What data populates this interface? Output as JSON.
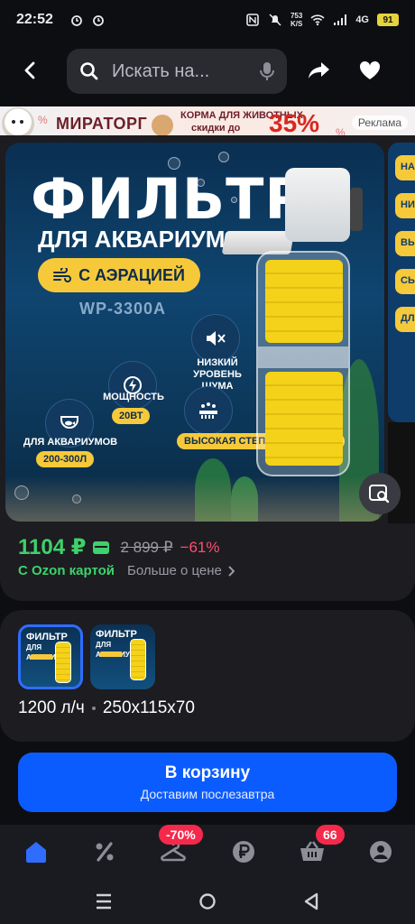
{
  "status_bar": {
    "time": "22:52",
    "speed_value": "753",
    "speed_unit": "K/S",
    "network": "4G",
    "battery": "91"
  },
  "topbar": {
    "search_placeholder": "Искать на..."
  },
  "ad_banner": {
    "brand": "МИРАТОРГ",
    "line1": "КОРМА ДЛЯ ЖИВОТНЫХ",
    "line2": "скидки до",
    "discount": "35%",
    "label": "Реклама"
  },
  "promo_image": {
    "title": "ФИЛЬТР",
    "subtitle": "ДЛЯ АКВАРИУМА",
    "pill": "С АЭРАЦИЕЙ",
    "model": "WP-3300A",
    "features": [
      {
        "label": "НИЗКИЙ УРОВЕНЬ ШУМА",
        "icon": "mute-speaker-icon"
      },
      {
        "label": "МОЩНОСТЬ",
        "badge": "20ВТ",
        "icon": "power-icon"
      },
      {
        "label": "ДЛЯ АКВАРИУМОВ",
        "badge": "200-300Л",
        "icon": "fishbowl-icon"
      },
      {
        "label": "ВЫСОКАЯ СТЕПЕНЬ ОЧИСТКИ",
        "icon": "water-drops-icon"
      }
    ],
    "next_slide_items": [
      "НА",
      "НИ",
      "ВЫ",
      "СЬ",
      "ДЛ"
    ]
  },
  "price": {
    "current": "1104 ₽",
    "old": "2 899 ₽",
    "discount": "−61%",
    "ozon_card": "С Ozon картой",
    "more_price": "Больше о цене"
  },
  "variants": {
    "thumb_title_line1": "ФИЛЬТР",
    "thumb_title_line2": "ДЛЯ АКВАРИУМА",
    "flow": "1200 л/ч",
    "size": "250x115x70"
  },
  "cart": {
    "title": "В корзину",
    "subtitle": "Доставим послезавтра"
  },
  "bottom_nav": {
    "items": [
      {
        "name": "home",
        "icon": "home-icon",
        "active": true
      },
      {
        "name": "sales",
        "icon": "percent-icon"
      },
      {
        "name": "fresh",
        "icon": "hanger-icon",
        "badge": "-70%"
      },
      {
        "name": "finance",
        "icon": "ruble-icon"
      },
      {
        "name": "cart",
        "icon": "basket-icon",
        "badge": "66"
      },
      {
        "name": "profile",
        "icon": "profile-icon"
      }
    ]
  },
  "colors": {
    "accent_blue": "#0b5cff",
    "price_green": "#3fd16b",
    "discount_red": "#ff4f6b",
    "badge_pink": "#f5294c",
    "promo_yellow": "#f6c93b"
  }
}
